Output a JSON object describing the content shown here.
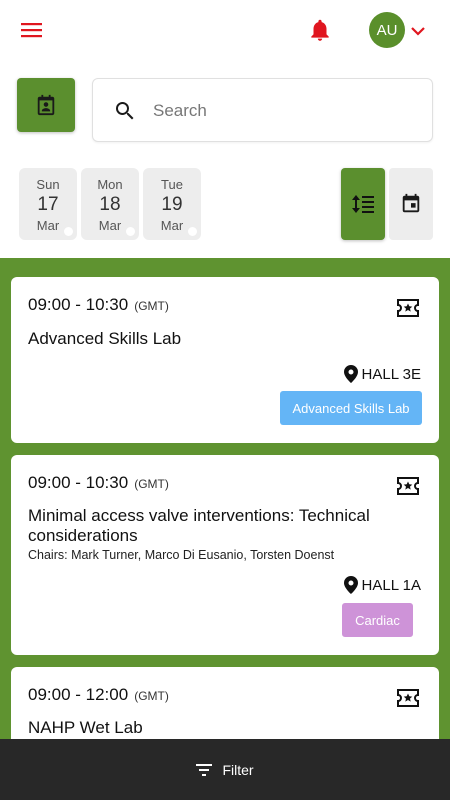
{
  "header": {
    "avatar_initials": "AU",
    "icons": [
      "menu-icon",
      "bell-icon",
      "chevron-down-icon"
    ],
    "accent_color": "#e0161f",
    "brand_color": "#5b8f2e"
  },
  "search": {
    "placeholder": "Search"
  },
  "days": [
    {
      "dow": "Sun",
      "num": "17",
      "month": "Mar"
    },
    {
      "dow": "Mon",
      "num": "18",
      "month": "Mar"
    },
    {
      "dow": "Tue",
      "num": "19",
      "month": "Mar"
    }
  ],
  "sessions": [
    {
      "time": "09:00 - 10:30",
      "tz": "(GMT)",
      "title": "Advanced Skills Lab",
      "chairs": "",
      "location": "HALL 3E",
      "tag": "Advanced Skills Lab",
      "tag_color": "#64b5f6"
    },
    {
      "time": "09:00 - 10:30",
      "tz": "(GMT)",
      "title": "Minimal access valve interventions: Technical considerations",
      "chairs": "Chairs: Mark Turner, Marco Di Eusanio, Torsten Doenst",
      "location": "HALL 1A",
      "tag": "Cardiac",
      "tag_color": "#ce93d8"
    },
    {
      "time": "09:00 - 12:00",
      "tz": "(GMT)",
      "title": "NAHP Wet Lab",
      "chairs": "",
      "location": "",
      "tag": "",
      "tag_color": ""
    }
  ],
  "footer": {
    "filter_label": "Filter"
  }
}
